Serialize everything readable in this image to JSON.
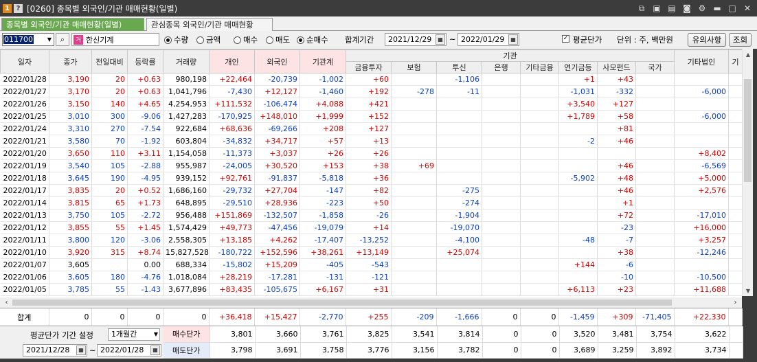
{
  "window": {
    "badge1": "1",
    "badge2": "?",
    "title": "[0260] 종목별 외국인/기관 매매현황(일별)"
  },
  "tabs": [
    {
      "label": "종목별 외국인/기관 매매현황(일별)"
    },
    {
      "label": "관심종목 외국인/기관 매매현황"
    }
  ],
  "toolbar": {
    "code": "011700",
    "name_badge": "거",
    "name": "한신기계",
    "radio_qty": "수량",
    "radio_amt": "금액",
    "radio_buy": "매수",
    "radio_sell": "매도",
    "radio_net": "순매수",
    "period_label": "합계기간",
    "date_from": "2021/12/29",
    "tilde": "~",
    "date_to": "2022/01/29",
    "avg_price_label": "평균단가",
    "unit_label": "단위 : 주, 백만원",
    "notice_button": "유의사항",
    "query_button": "조회"
  },
  "columns": {
    "date": "일자",
    "close": "종가",
    "change": "전일대비",
    "rate": "등락률",
    "volume": "거래량",
    "individual": "개인",
    "foreign": "외국인",
    "inst_total": "기관계",
    "inst_group": "기관",
    "finance": "금융투자",
    "insurance": "보험",
    "trust": "투신",
    "bank": "은행",
    "other_fin": "기타금융",
    "pension": "연기금등",
    "pe_fund": "사모펀드",
    "gov": "국가",
    "other_corp": "기타법인",
    "more": "기"
  },
  "rows": [
    {
      "date": "2022/01/28",
      "close": "3,190",
      "change": "20",
      "rate": "+0.63",
      "volume": "980,198",
      "individual": "+22,464",
      "foreign": "-20,739",
      "inst": "-1,002",
      "finance": "+60",
      "insurance": "",
      "trust": "-1,106",
      "bank": "",
      "other_fin": "",
      "pension": "+1",
      "pe": "+43",
      "gov": "",
      "corp": "",
      "dir": "up"
    },
    {
      "date": "2022/01/27",
      "close": "3,170",
      "change": "20",
      "rate": "+0.63",
      "volume": "1,041,796",
      "individual": "-7,430",
      "foreign": "+12,127",
      "inst": "-1,460",
      "finance": "+192",
      "insurance": "-278",
      "trust": "-11",
      "bank": "",
      "other_fin": "",
      "pension": "-1,031",
      "pe": "-332",
      "gov": "",
      "corp": "-6,000",
      "dir": "up"
    },
    {
      "date": "2022/01/26",
      "close": "3,150",
      "change": "140",
      "rate": "+4.65",
      "volume": "4,254,953",
      "individual": "+111,532",
      "foreign": "-106,474",
      "inst": "+4,088",
      "finance": "+421",
      "insurance": "",
      "trust": "",
      "bank": "",
      "other_fin": "",
      "pension": "+3,540",
      "pe": "+127",
      "gov": "",
      "corp": "",
      "dir": "up"
    },
    {
      "date": "2022/01/25",
      "close": "3,010",
      "change": "300",
      "rate": "-9.06",
      "volume": "1,427,283",
      "individual": "-170,925",
      "foreign": "+148,010",
      "inst": "+1,999",
      "finance": "+152",
      "insurance": "",
      "trust": "",
      "bank": "",
      "other_fin": "",
      "pension": "+1,789",
      "pe": "+58",
      "gov": "",
      "corp": "-6,000",
      "dir": "down"
    },
    {
      "date": "2022/01/24",
      "close": "3,310",
      "change": "270",
      "rate": "-7.54",
      "volume": "922,684",
      "individual": "+68,636",
      "foreign": "-69,266",
      "inst": "+208",
      "finance": "+127",
      "insurance": "",
      "trust": "",
      "bank": "",
      "other_fin": "",
      "pension": "",
      "pe": "+81",
      "gov": "",
      "corp": "",
      "dir": "down"
    },
    {
      "date": "2022/01/21",
      "close": "3,580",
      "change": "70",
      "rate": "-1.92",
      "volume": "603,804",
      "individual": "-34,832",
      "foreign": "+34,717",
      "inst": "+57",
      "finance": "+13",
      "insurance": "",
      "trust": "",
      "bank": "",
      "other_fin": "",
      "pension": "-2",
      "pe": "+46",
      "gov": "",
      "corp": "",
      "dir": "down"
    },
    {
      "date": "2022/01/20",
      "close": "3,650",
      "change": "110",
      "rate": "+3.11",
      "volume": "1,154,058",
      "individual": "-11,373",
      "foreign": "+3,037",
      "inst": "+26",
      "finance": "+26",
      "insurance": "",
      "trust": "",
      "bank": "",
      "other_fin": "",
      "pension": "",
      "pe": "",
      "gov": "",
      "corp": "+8,402",
      "dir": "up"
    },
    {
      "date": "2022/01/19",
      "close": "3,540",
      "change": "105",
      "rate": "-2.88",
      "volume": "955,987",
      "individual": "-24,005",
      "foreign": "+30,520",
      "inst": "+153",
      "finance": "+38",
      "insurance": "+69",
      "trust": "",
      "bank": "",
      "other_fin": "",
      "pension": "",
      "pe": "+46",
      "gov": "",
      "corp": "-6,569",
      "dir": "down"
    },
    {
      "date": "2022/01/18",
      "close": "3,645",
      "change": "190",
      "rate": "-4.95",
      "volume": "939,152",
      "individual": "+92,761",
      "foreign": "-91,837",
      "inst": "-5,818",
      "finance": "+36",
      "insurance": "",
      "trust": "",
      "bank": "",
      "other_fin": "",
      "pension": "-5,902",
      "pe": "+48",
      "gov": "",
      "corp": "+5,000",
      "dir": "down"
    },
    {
      "date": "2022/01/17",
      "close": "3,835",
      "change": "20",
      "rate": "+0.52",
      "volume": "1,686,160",
      "individual": "-29,732",
      "foreign": "+27,704",
      "inst": "-147",
      "finance": "+82",
      "insurance": "",
      "trust": "-275",
      "bank": "",
      "other_fin": "",
      "pension": "",
      "pe": "+46",
      "gov": "",
      "corp": "+2,576",
      "dir": "up"
    },
    {
      "date": "2022/01/14",
      "close": "3,815",
      "change": "65",
      "rate": "+1.73",
      "volume": "648,895",
      "individual": "-29,510",
      "foreign": "+28,936",
      "inst": "-223",
      "finance": "+50",
      "insurance": "",
      "trust": "-274",
      "bank": "",
      "other_fin": "",
      "pension": "",
      "pe": "+1",
      "gov": "",
      "corp": "",
      "dir": "up"
    },
    {
      "date": "2022/01/13",
      "close": "3,750",
      "change": "105",
      "rate": "-2.72",
      "volume": "956,488",
      "individual": "+151,869",
      "foreign": "-132,507",
      "inst": "-1,858",
      "finance": "-26",
      "insurance": "",
      "trust": "-1,904",
      "bank": "",
      "other_fin": "",
      "pension": "",
      "pe": "+72",
      "gov": "",
      "corp": "-17,010",
      "dir": "down"
    },
    {
      "date": "2022/01/12",
      "close": "3,855",
      "change": "55",
      "rate": "+1.45",
      "volume": "1,574,429",
      "individual": "+49,773",
      "foreign": "-47,456",
      "inst": "-19,079",
      "finance": "+14",
      "insurance": "",
      "trust": "-19,070",
      "bank": "",
      "other_fin": "",
      "pension": "",
      "pe": "-23",
      "gov": "",
      "corp": "+16,000",
      "dir": "up"
    },
    {
      "date": "2022/01/11",
      "close": "3,800",
      "change": "120",
      "rate": "-3.06",
      "volume": "2,558,305",
      "individual": "+13,185",
      "foreign": "+4,262",
      "inst": "-17,407",
      "finance": "-13,252",
      "insurance": "",
      "trust": "-4,100",
      "bank": "",
      "other_fin": "",
      "pension": "-48",
      "pe": "-7",
      "gov": "",
      "corp": "+3,257",
      "dir": "down"
    },
    {
      "date": "2022/01/10",
      "close": "3,920",
      "change": "315",
      "rate": "+8.74",
      "volume": "15,827,528",
      "individual": "-180,722",
      "foreign": "+152,596",
      "inst": "+38,261",
      "finance": "+13,149",
      "insurance": "",
      "trust": "+25,074",
      "bank": "",
      "other_fin": "",
      "pension": "",
      "pe": "+38",
      "gov": "",
      "corp": "-12,246",
      "dir": "up"
    },
    {
      "date": "2022/01/07",
      "close": "3,605",
      "change": "",
      "rate": "0.00",
      "volume": "688,334",
      "individual": "-15,802",
      "foreign": "+15,209",
      "inst": "-405",
      "finance": "-543",
      "insurance": "",
      "trust": "",
      "bank": "",
      "other_fin": "",
      "pension": "+144",
      "pe": "-6",
      "gov": "",
      "corp": "",
      "dir": "flat"
    },
    {
      "date": "2022/01/06",
      "close": "3,605",
      "change": "180",
      "rate": "-4.76",
      "volume": "1,018,084",
      "individual": "+28,219",
      "foreign": "-17,281",
      "inst": "-131",
      "finance": "-121",
      "insurance": "",
      "trust": "",
      "bank": "",
      "other_fin": "",
      "pension": "",
      "pe": "-10",
      "gov": "",
      "corp": "-10,500",
      "dir": "down"
    },
    {
      "date": "2022/01/05",
      "close": "3,785",
      "change": "55",
      "rate": "-1.43",
      "volume": "3,677,896",
      "individual": "+83,435",
      "foreign": "-105,675",
      "inst": "+6,167",
      "finance": "+31",
      "insurance": "",
      "trust": "",
      "bank": "",
      "other_fin": "",
      "pension": "+6,113",
      "pe": "+23",
      "gov": "",
      "corp": "+11,688",
      "dir": "down"
    }
  ],
  "totals": {
    "label": "합계",
    "close": "0",
    "change": "0",
    "rate": "0",
    "volume": "0",
    "individual": "+36,418",
    "foreign": "+15,427",
    "inst": "-2,770",
    "finance": "+255",
    "insurance": "-209",
    "trust": "-1,666",
    "bank": "0",
    "other_fin": "0",
    "pension": "-1,459",
    "pe": "+309",
    "gov": "-71,405",
    "corp": "+22,330"
  },
  "avg_panel": {
    "title": "평균단가 기간 설정",
    "period_select": "1개월간",
    "date_from": "2021/12/28",
    "tilde": "~",
    "date_to": "2022/01/28",
    "buy_label": "매수단가",
    "sell_label": "매도단가",
    "buy": [
      "3,801",
      "3,660",
      "3,761",
      "3,825",
      "3,541",
      "3,814",
      "0",
      "0",
      "3,520",
      "3,481",
      "3,754",
      "3,622"
    ],
    "sell": [
      "3,798",
      "3,691",
      "3,758",
      "3,776",
      "3,156",
      "3,782",
      "0",
      "0",
      "3,689",
      "3,259",
      "3,892",
      "3,734"
    ]
  },
  "colors": {
    "up": "#d40000",
    "down": "#0a3ec8",
    "tab_active": "#6aa84f",
    "header_individual": "#fde3e3",
    "header_foreign": "#e4ecfa"
  }
}
